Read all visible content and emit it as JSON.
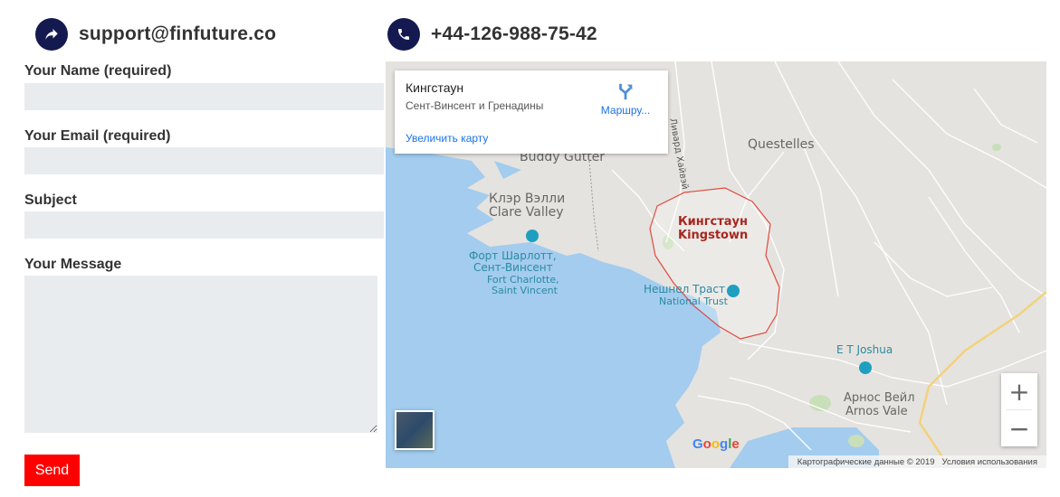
{
  "contact": {
    "email": "support@finfuture.co",
    "phone": "+44-126-988-75-42"
  },
  "form": {
    "name_label": "Your Name (required)",
    "email_label": "Your Email (required)",
    "subject_label": "Subject",
    "message_label": "Your Message",
    "name_value": "",
    "email_value": "",
    "subject_value": "",
    "message_value": "",
    "send_label": "Send"
  },
  "map": {
    "info": {
      "title": "Кингстаун",
      "subtitle": "Сент-Винсент и Гренадины",
      "directions": "Маршру...",
      "enlarge": "Увеличить карту"
    },
    "labels": {
      "questelles": "Questelles",
      "buddy_gutter": "Buddy Gutter",
      "clare_valley_ru": "Клэр Вэлли",
      "clare_valley": "Clare Valley",
      "fort_ru_1": "Форт Шарлотт,",
      "fort_ru_2": "Сент-Винсент",
      "fort_en_1": "Fort Charlotte,",
      "fort_en_2": "Saint Vincent",
      "city_ru": "Кингстаун",
      "city_en": "Kingstown",
      "trust_ru": "Нешнел Траст",
      "trust_en": "National Trust",
      "et_joshua": "E T Joshua",
      "arnos_ru": "Арнос Вейл",
      "arnos_en": "Arnos Vale",
      "road": "Ливард Хайвэй"
    },
    "google": "Google",
    "attribution_data": "Картографические данные © 2019",
    "attribution_terms": "Условия использования",
    "zoom_in": "+",
    "zoom_out": "−"
  },
  "colors": {
    "icon_bg": "#141a4f",
    "send_bg": "#ff0000",
    "input_bg": "#e9ecef",
    "sea": "#a3ccee",
    "land": "#e5e3df",
    "city_outline": "#e04a3f"
  }
}
